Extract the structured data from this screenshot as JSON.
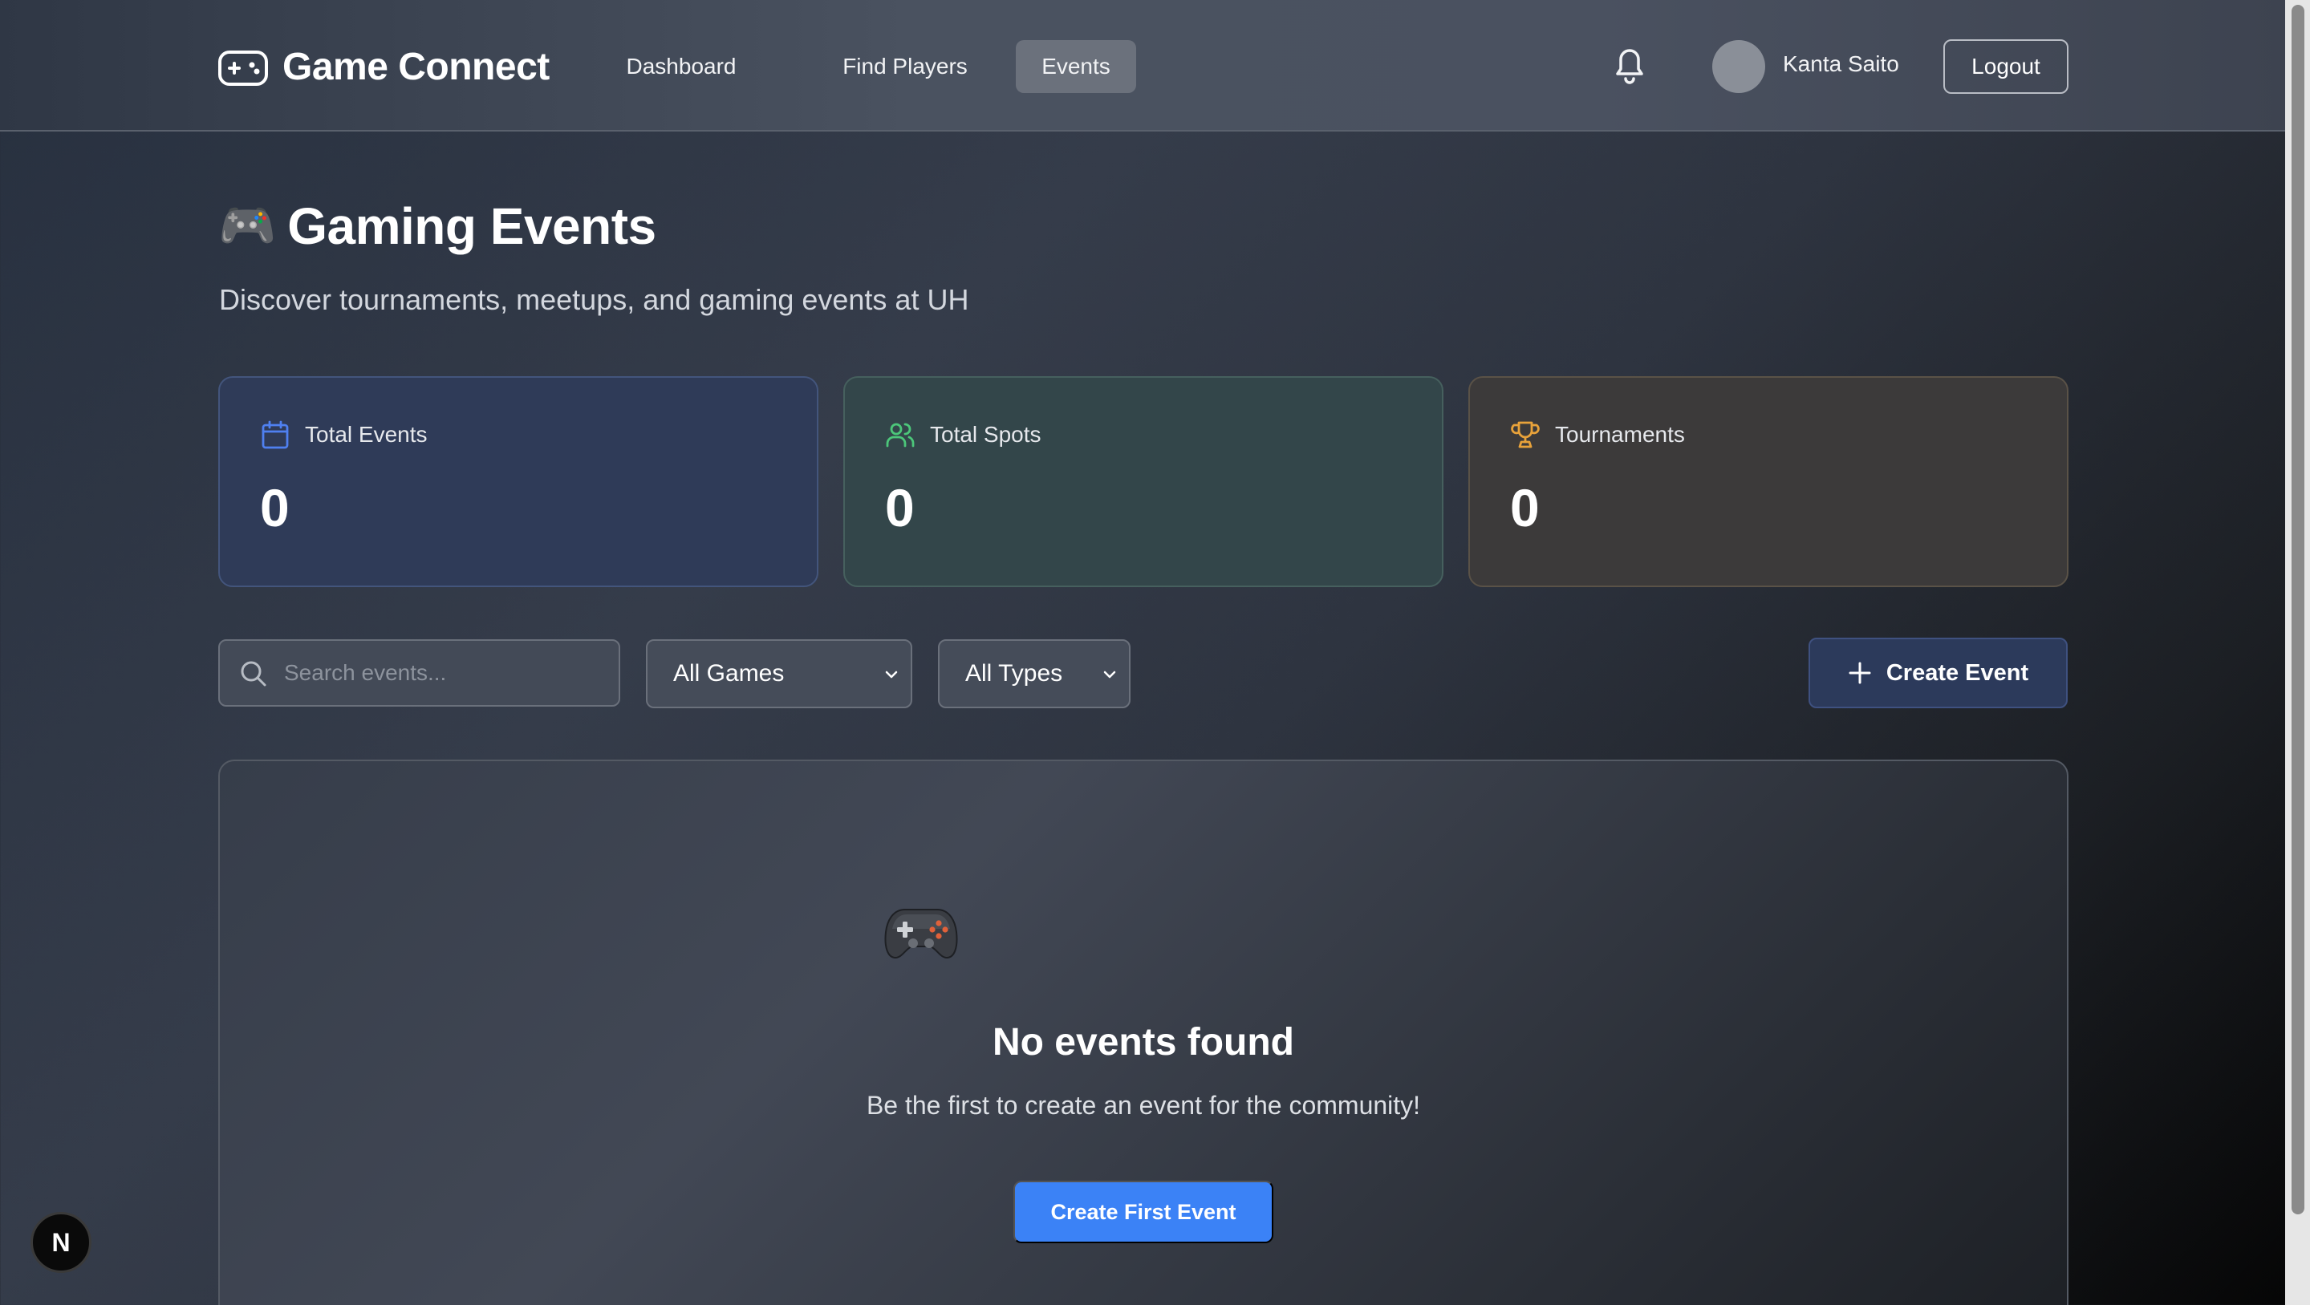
{
  "header": {
    "brand": "Game Connect",
    "nav": [
      {
        "label": "Dashboard",
        "active": false
      },
      {
        "label": "Find Players",
        "active": false
      },
      {
        "label": "Events",
        "active": true
      }
    ],
    "user_name": "Kanta Saito",
    "logout_label": "Logout"
  },
  "page": {
    "title_emoji": "🎮",
    "title": "Gaming Events",
    "subtitle": "Discover tournaments, meetups, and gaming events at UH"
  },
  "stats": [
    {
      "label": "Total Events",
      "value": "0",
      "icon": "calendar-icon",
      "color": "#4f80f0"
    },
    {
      "label": "Total Spots",
      "value": "0",
      "icon": "users-icon",
      "color": "#4cc77a"
    },
    {
      "label": "Tournaments",
      "value": "0",
      "icon": "trophy-icon",
      "color": "#e8a23a"
    }
  ],
  "filters": {
    "search_placeholder": "Search events...",
    "game_select": "All Games",
    "type_select": "All Types",
    "create_label": "Create Event"
  },
  "empty_state": {
    "icon": "gamepad-icon",
    "title": "No events found",
    "subtitle": "Be the first to create an event for the community!",
    "button_label": "Create First Event"
  },
  "badge": "N",
  "colors": {
    "accent": "#3b82f6",
    "active_nav": "#6b717c"
  }
}
